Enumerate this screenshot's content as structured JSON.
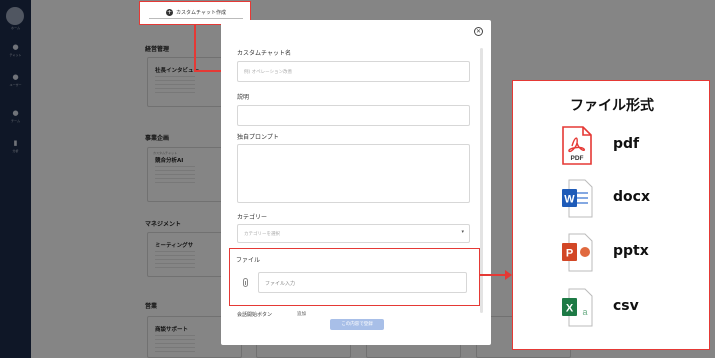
{
  "callout": {
    "create_label": "カスタムチャット作成"
  },
  "modal": {
    "name_label": "カスタムチャット名",
    "name_placeholder": "例) オペレーション改善",
    "desc_label": "説明",
    "prompt_label": "独自プロンプト",
    "category_label": "カテゴリー",
    "category_placeholder": "カテゴリーを選択",
    "file_label": "ファイル",
    "file_placeholder": "ファイル入力",
    "start_button_label": "会話開始ボタン",
    "add_label": "追加",
    "submit_label": "この内容で登録"
  },
  "file_formats": {
    "title": "ファイル形式",
    "items": [
      {
        "label": "pdf",
        "icon": "pdf-file-icon",
        "icon_text": "PDF",
        "color": "#e53935"
      },
      {
        "label": "docx",
        "icon": "word-file-icon",
        "icon_text": "W",
        "color": "#1e5bb8"
      },
      {
        "label": "pptx",
        "icon": "powerpoint-file-icon",
        "icon_text": "P",
        "color": "#d24726"
      },
      {
        "label": "csv",
        "icon": "excel-file-icon",
        "icon_text": "X",
        "color": "#1d7a45"
      }
    ]
  },
  "background": {
    "sections": [
      "経営管理",
      "事業企画",
      "マネジメント",
      "営業"
    ],
    "cards": [
      {
        "title": "社長インタビュー"
      },
      {
        "title": "競合分析AI",
        "tag": "カスタムチャット"
      },
      {
        "title": "ミーティングサ"
      },
      {
        "title": "商談サポート"
      }
    ]
  },
  "colors": {
    "highlight": "#e53935",
    "sidebar": "#1d2d4c",
    "submit": "#a8bfe8"
  }
}
